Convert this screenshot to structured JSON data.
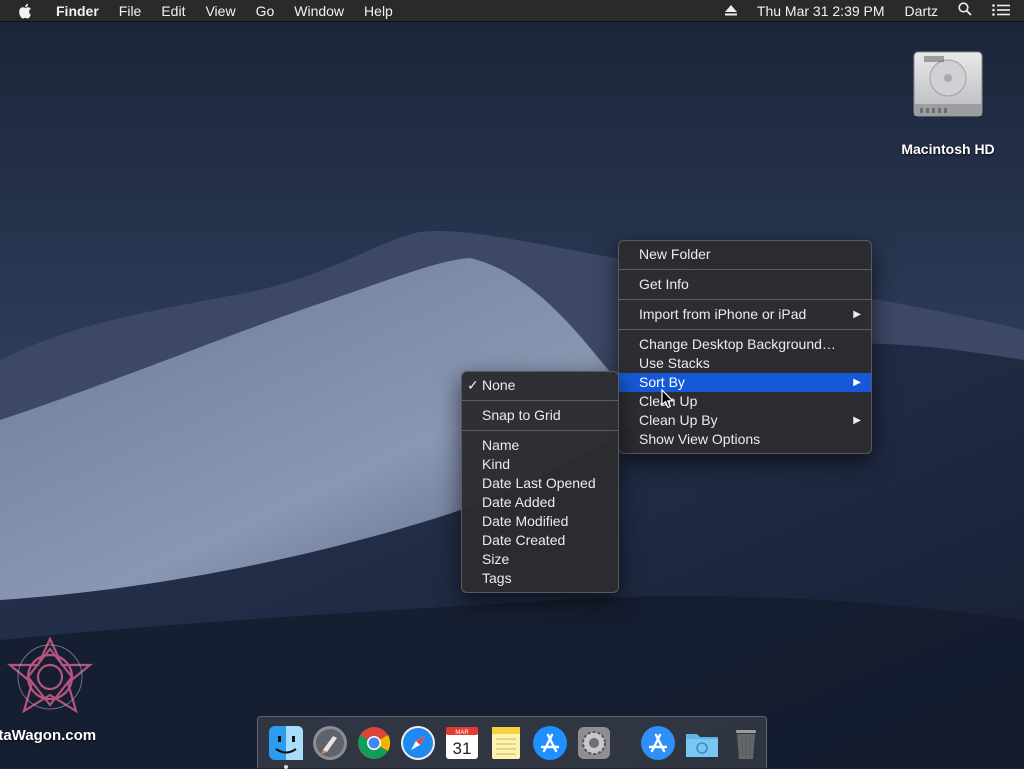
{
  "menubar": {
    "app": "Finder",
    "menus": [
      "File",
      "Edit",
      "View",
      "Go",
      "Window",
      "Help"
    ],
    "clock": "Thu Mar 31  2:39 PM",
    "user": "Dartz"
  },
  "desktop_icons": [
    {
      "label": "Macintosh HD",
      "icon": "hard-drive-icon"
    }
  ],
  "context_menu": {
    "items": {
      "new_folder": "New Folder",
      "get_info": "Get Info",
      "import": "Import from iPhone or iPad",
      "change_bg": "Change Desktop Background…",
      "use_stacks": "Use Stacks",
      "sort_by": "Sort By",
      "clean_up": "Clean Up",
      "clean_up_by": "Clean Up By",
      "show_view_options": "Show View Options"
    },
    "highlighted": "Sort By",
    "highlight_color": "#1659d8"
  },
  "submenu": {
    "items": {
      "none": "None",
      "snap": "Snap to Grid",
      "name": "Name",
      "kind": "Kind",
      "date_last_opened": "Date Last Opened",
      "date_added": "Date Added",
      "date_modified": "Date Modified",
      "date_created": "Date Created",
      "size": "Size",
      "tags": "Tags"
    },
    "checked": "None",
    "check_glyph": "✓"
  },
  "dock": {
    "items": [
      "finder-icon",
      "launchpad-icon",
      "chrome-icon",
      "safari-icon",
      "calendar-icon",
      "notes-icon",
      "app-store-icon",
      "system-preferences-icon",
      "app-store-folder-icon",
      "downloads-folder-icon",
      "trash-icon"
    ],
    "calendar": {
      "month": "MAR",
      "day": "31"
    }
  },
  "watermark": {
    "text": "ataWagon.com"
  },
  "colors": {
    "menu_bg": "#2c2c30",
    "desktop": "#1b2740"
  }
}
